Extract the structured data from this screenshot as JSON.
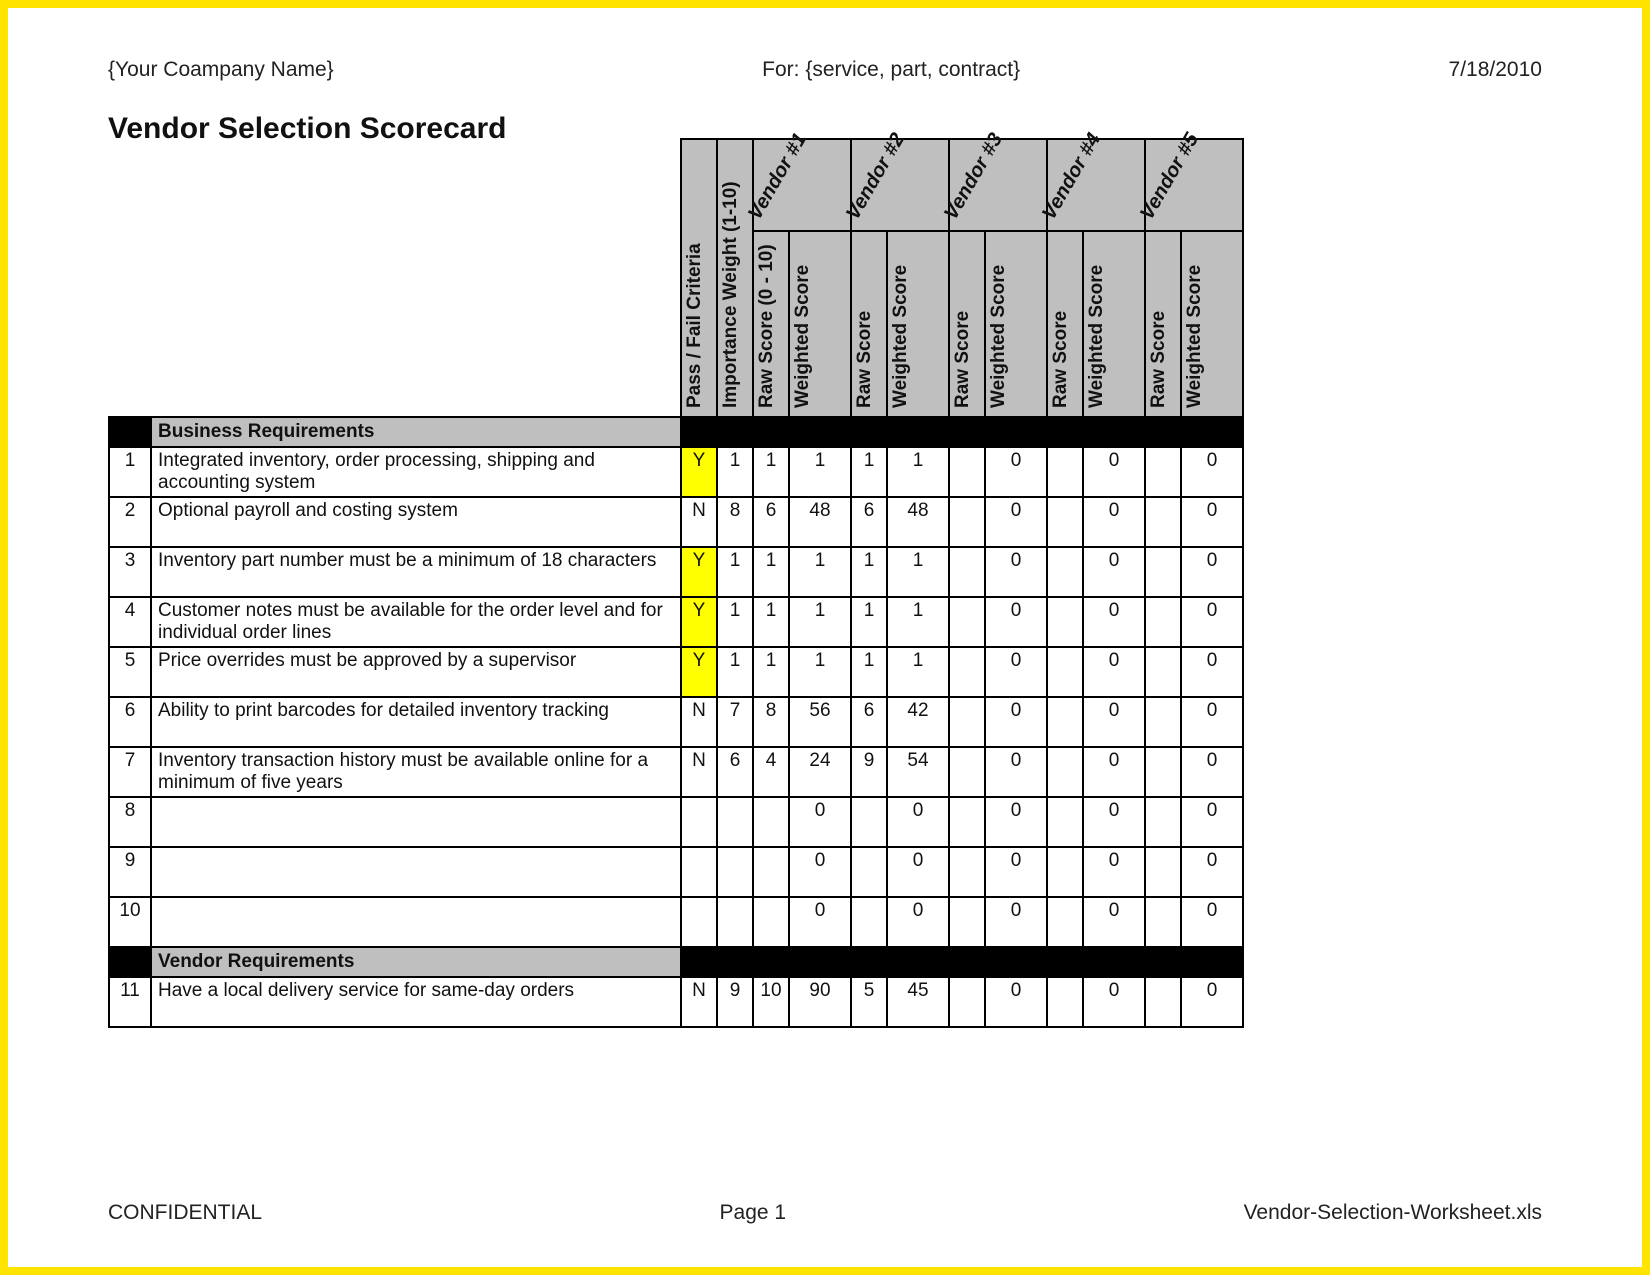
{
  "header": {
    "left": "{Your Coampany Name}",
    "center": "For: {service, part, contract}",
    "right": "7/18/2010"
  },
  "title": "Vendor Selection Scorecard",
  "footer": {
    "left": "CONFIDENTIAL",
    "center": "Page 1",
    "right": "Vendor-Selection-Worksheet.xls"
  },
  "column_headers": {
    "pass_fail": "Pass / Fail Criteria",
    "importance": "Importance Weight (1-10)",
    "raw_full": "Raw Score (0 - 10)",
    "raw_short": "Raw Score",
    "weighted": "Weighted Score"
  },
  "vendors": {
    "v1": "Vendor #1",
    "v2": "Vendor #2",
    "v3": "Vendor #3",
    "v4": "Vendor #4",
    "v5": "Vendor #5"
  },
  "sections": {
    "s1": "Business Requirements",
    "s2": "Vendor Requirements"
  },
  "rows": {
    "r1": {
      "n": "1",
      "desc": "Integrated inventory, order processing, shipping and accounting system",
      "pf": "Y",
      "wt": "1",
      "v1r": "1",
      "v1w": "1",
      "v2r": "1",
      "v2w": "1",
      "v3r": "",
      "v3w": "0",
      "v4r": "",
      "v4w": "0",
      "v5r": "",
      "v5w": "0"
    },
    "r2": {
      "n": "2",
      "desc": "Optional payroll and costing system",
      "pf": "N",
      "wt": "8",
      "v1r": "6",
      "v1w": "48",
      "v2r": "6",
      "v2w": "48",
      "v3r": "",
      "v3w": "0",
      "v4r": "",
      "v4w": "0",
      "v5r": "",
      "v5w": "0"
    },
    "r3": {
      "n": "3",
      "desc": "Inventory part number must be a minimum of 18 characters",
      "pf": "Y",
      "wt": "1",
      "v1r": "1",
      "v1w": "1",
      "v2r": "1",
      "v2w": "1",
      "v3r": "",
      "v3w": "0",
      "v4r": "",
      "v4w": "0",
      "v5r": "",
      "v5w": "0"
    },
    "r4": {
      "n": "4",
      "desc": "Customer notes must be available for the order level and for individual order lines",
      "pf": "Y",
      "wt": "1",
      "v1r": "1",
      "v1w": "1",
      "v2r": "1",
      "v2w": "1",
      "v3r": "",
      "v3w": "0",
      "v4r": "",
      "v4w": "0",
      "v5r": "",
      "v5w": "0"
    },
    "r5": {
      "n": "5",
      "desc": "Price overrides must be approved by a supervisor",
      "pf": "Y",
      "wt": "1",
      "v1r": "1",
      "v1w": "1",
      "v2r": "1",
      "v2w": "1",
      "v3r": "",
      "v3w": "0",
      "v4r": "",
      "v4w": "0",
      "v5r": "",
      "v5w": "0"
    },
    "r6": {
      "n": "6",
      "desc": "Ability to print barcodes for detailed inventory tracking",
      "pf": "N",
      "wt": "7",
      "v1r": "8",
      "v1w": "56",
      "v2r": "6",
      "v2w": "42",
      "v3r": "",
      "v3w": "0",
      "v4r": "",
      "v4w": "0",
      "v5r": "",
      "v5w": "0"
    },
    "r7": {
      "n": "7",
      "desc": "Inventory transaction history must be available online for a minimum of five years",
      "pf": "N",
      "wt": "6",
      "v1r": "4",
      "v1w": "24",
      "v2r": "9",
      "v2w": "54",
      "v3r": "",
      "v3w": "0",
      "v4r": "",
      "v4w": "0",
      "v5r": "",
      "v5w": "0"
    },
    "r8": {
      "n": "8",
      "desc": "",
      "pf": "",
      "wt": "",
      "v1r": "",
      "v1w": "0",
      "v2r": "",
      "v2w": "0",
      "v3r": "",
      "v3w": "0",
      "v4r": "",
      "v4w": "0",
      "v5r": "",
      "v5w": "0"
    },
    "r9": {
      "n": "9",
      "desc": "",
      "pf": "",
      "wt": "",
      "v1r": "",
      "v1w": "0",
      "v2r": "",
      "v2w": "0",
      "v3r": "",
      "v3w": "0",
      "v4r": "",
      "v4w": "0",
      "v5r": "",
      "v5w": "0"
    },
    "r10": {
      "n": "10",
      "desc": "",
      "pf": "",
      "wt": "",
      "v1r": "",
      "v1w": "0",
      "v2r": "",
      "v2w": "0",
      "v3r": "",
      "v3w": "0",
      "v4r": "",
      "v4w": "0",
      "v5r": "",
      "v5w": "0"
    },
    "r11": {
      "n": "11",
      "desc": "Have a local delivery service for same-day orders",
      "pf": "N",
      "wt": "9",
      "v1r": "10",
      "v1w": "90",
      "v2r": "5",
      "v2w": "45",
      "v3r": "",
      "v3w": "0",
      "v4r": "",
      "v4w": "0",
      "v5r": "",
      "v5w": "0"
    }
  }
}
